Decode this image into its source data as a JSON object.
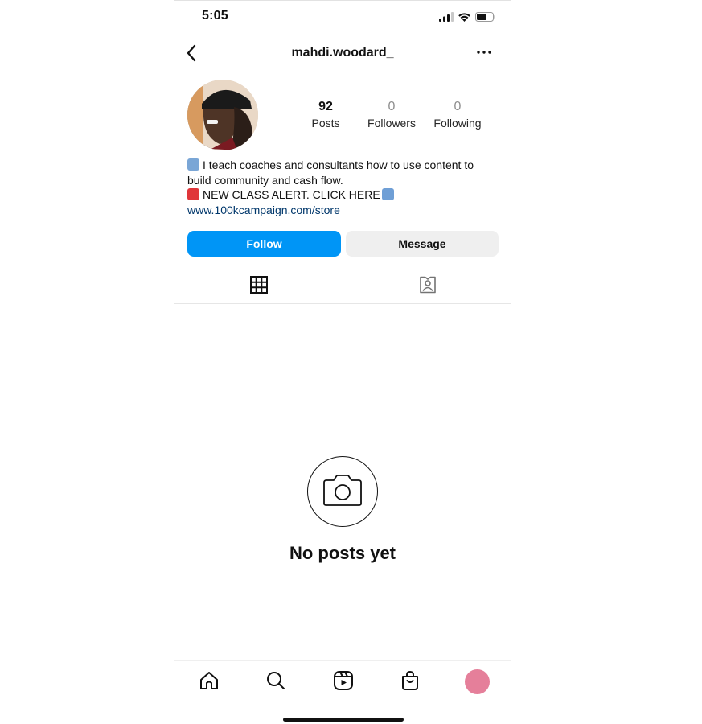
{
  "status_bar": {
    "time": "5:05",
    "icons": [
      "cellular-signal-icon",
      "wifi-icon",
      "battery-icon"
    ]
  },
  "header": {
    "username": "mahdi.woodard_",
    "back_icon": "chevron-left-icon",
    "more_icon": "more-horizontal-icon"
  },
  "profile": {
    "avatar": "profile-photo",
    "stats": [
      {
        "value": "92",
        "label": "Posts"
      },
      {
        "value": "0",
        "label": "Followers"
      },
      {
        "value": "0",
        "label": "Following"
      }
    ],
    "bio": {
      "line1": "I teach coaches and consultants how to use content to build community and cash flow.",
      "line2": "NEW CLASS ALERT. CLICK HERE",
      "link": "www.100kcampaign.com/store",
      "emojis": [
        "bar-chart-emoji",
        "siren-emoji",
        "down-left-arrow-emoji"
      ]
    }
  },
  "actions": {
    "follow_label": "Follow",
    "message_label": "Message"
  },
  "tabs": [
    {
      "name": "posts-grid",
      "icon": "grid-icon",
      "active": true
    },
    {
      "name": "tagged",
      "icon": "tagged-person-icon",
      "active": false
    }
  ],
  "empty_state": {
    "icon": "camera-icon",
    "message": "No posts yet"
  },
  "bottom_nav": [
    {
      "name": "home",
      "icon": "home-icon"
    },
    {
      "name": "search",
      "icon": "search-icon"
    },
    {
      "name": "reels",
      "icon": "reels-icon"
    },
    {
      "name": "shop",
      "icon": "shopping-bag-icon"
    },
    {
      "name": "profile",
      "icon": "profile-avatar"
    }
  ],
  "colors": {
    "follow_button": "#0095f6",
    "message_button": "#efefef",
    "link": "#00376b",
    "profile_avatar": "#e57f9a"
  }
}
